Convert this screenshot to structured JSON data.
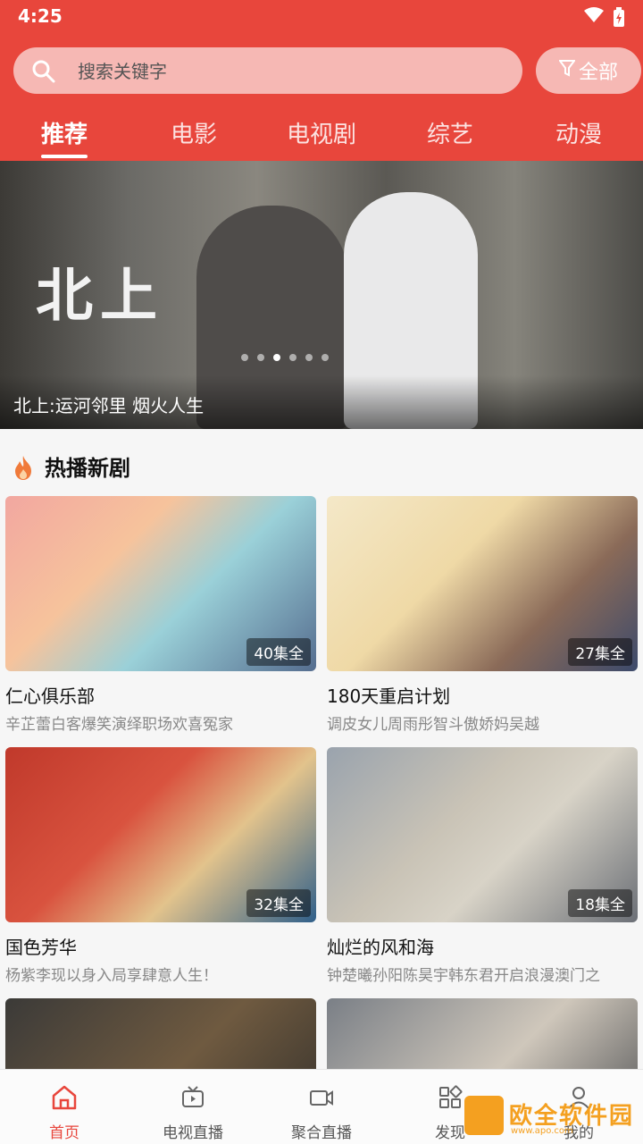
{
  "status_bar": {
    "time": "4:25"
  },
  "search": {
    "placeholder": "搜索关键字"
  },
  "filter": {
    "label": "全部"
  },
  "tabs": [
    {
      "label": "推荐"
    },
    {
      "label": "电影"
    },
    {
      "label": "电视剧"
    },
    {
      "label": "综艺"
    },
    {
      "label": "动漫"
    }
  ],
  "active_tab": "推荐",
  "banner": {
    "art_title": "北上",
    "caption": "北上:运河邻里 烟火人生",
    "slide_count": 6,
    "active_slide": 3
  },
  "section": {
    "title": "热播新剧",
    "icon": "fire-icon"
  },
  "cards": [
    {
      "title": "仁心俱乐部",
      "subtitle": "辛芷蕾白客爆笑演绎职场欢喜冤家",
      "episodes": "40集全"
    },
    {
      "title": "180天重启计划",
      "subtitle": "调皮女儿周雨彤智斗傲娇妈吴越",
      "episodes": "27集全"
    },
    {
      "title": "国色芳华",
      "subtitle": "杨紫李现以身入局享肆意人生！",
      "episodes": "32集全"
    },
    {
      "title": "灿烂的风和海",
      "subtitle": "钟楚曦孙阳陈昊宇韩东君开启浪漫澳门之",
      "episodes": "18集全"
    },
    {
      "title": "",
      "subtitle": "",
      "episodes": ""
    },
    {
      "title": "",
      "subtitle": "",
      "episodes": ""
    }
  ],
  "bottom_nav": [
    {
      "label": "首页",
      "icon": "home-icon"
    },
    {
      "label": "电视直播",
      "icon": "tv-icon"
    },
    {
      "label": "聚合直播",
      "icon": "video-camera-icon"
    },
    {
      "label": "发现",
      "icon": "grid-icon"
    },
    {
      "label": "我的",
      "icon": "user-icon"
    }
  ],
  "watermark": {
    "text": "欧全软件园",
    "sub": "www.apo.com"
  },
  "colors": {
    "accent": "#e8463c",
    "header_bg": "#e8463c",
    "watermark": "#f4a020"
  }
}
